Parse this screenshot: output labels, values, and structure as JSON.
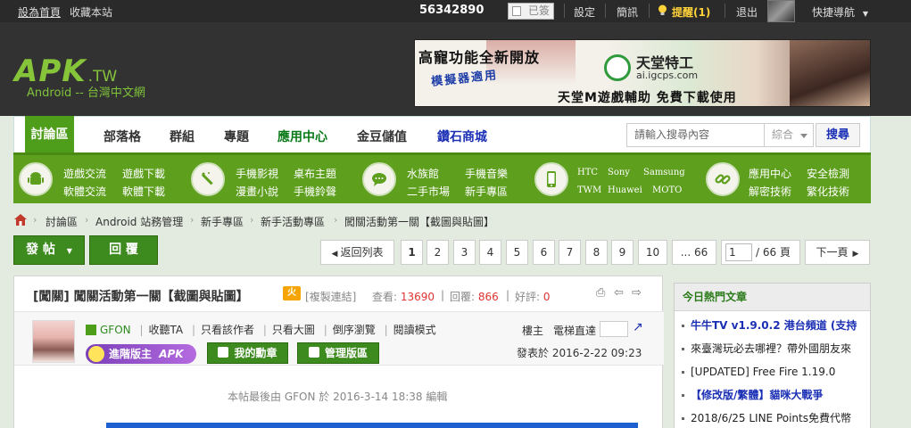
{
  "topbar": {
    "set_home": "設為首頁",
    "bookmark": "收藏本站",
    "user_id": "56342890",
    "signed": "已簽",
    "settings": "設定",
    "messages": "簡訊",
    "remind": "提醒(1)",
    "logout": "退出",
    "quick_nav": "快捷導航"
  },
  "logo": {
    "brand": "APK",
    "tld": ".TW",
    "subtitle": "Android -- 台灣中文網"
  },
  "banner": {
    "line1": "高寵功能全新開放",
    "line2": "模擬器適用",
    "brand": "天堂特工",
    "domain": "ai.igcps.com",
    "tagline": "天堂M遊戲輔助 免費下載使用"
  },
  "nav": {
    "items": [
      "討論區",
      "部落格",
      "群組",
      "專題",
      "應用中心",
      "金豆儲值",
      "鑽石商城"
    ],
    "search_placeholder": "請輸入搜尋內容",
    "search_type": "綜合",
    "search_button": "搜尋"
  },
  "categories": [
    {
      "icon": "android-icon",
      "links": [
        "遊戲交流",
        "遊戲下載",
        "軟體交流",
        "軟體下載"
      ]
    },
    {
      "icon": "magic-wand-icon",
      "links": [
        "手機影視",
        "桌布主題",
        "漫畫小說",
        "手機鈴聲"
      ]
    },
    {
      "icon": "chat-bubble-icon",
      "links": [
        "水族館",
        "手機音樂",
        "二手市場",
        "新手專區"
      ]
    },
    {
      "icon": "smartphone-icon",
      "links": [
        "HTC",
        "Sony",
        "Samsung",
        "TWM",
        "Huawei",
        "MOTO"
      ]
    },
    {
      "icon": "link-icon",
      "links": [
        "應用中心",
        "安全檢測",
        "解密技術",
        "繁化技術"
      ]
    }
  ],
  "breadcrumb": [
    "討論區",
    "Android 站務管理",
    "新手專區",
    "新手活動專區",
    "闖關活動第一關【截圖與貼圖】"
  ],
  "actions": {
    "post": "發 帖",
    "reply": "回 覆"
  },
  "pager": {
    "back": "返回列表",
    "pages": [
      "1",
      "2",
      "3",
      "4",
      "5",
      "6",
      "7",
      "8",
      "9",
      "10",
      "... 66"
    ],
    "current": "1",
    "total": "/ 66 頁",
    "next": "下一頁"
  },
  "thread": {
    "title": "[闖關] 闖關活動第一關【截圖與貼圖】",
    "hot": "火",
    "copy_link": "[複製連結]",
    "views_label": "查看:",
    "views": "13690",
    "replies_label": "回覆:",
    "replies": "866",
    "likes_label": "好評:",
    "likes": "0"
  },
  "author": {
    "name": "GFON",
    "listen": "收聽TA",
    "only_author": "只看該作者",
    "only_big": "只看大圖",
    "reverse": "倒序瀏覽",
    "read_mode": "閱讀模式",
    "rank": "進階版主",
    "medal_btn": "我的勳章",
    "manage_btn": "管理版區",
    "owner": "樓主",
    "elevator": "電梯直達",
    "posted_label": "發表於",
    "posted_at": "2016-2-22 09:23",
    "edit_note": "本帖最後由 GFON 於 2016-3-14 18:38 編輯"
  },
  "sidebar": {
    "title": "今日熱門文章",
    "items": [
      "牛牛TV v1.9.0.2 港台頻道 (支持",
      "來臺灣玩必去哪裡？帶外國朋友來",
      "[UPDATED] Free Fire 1.19.0",
      "【修改版/繁體】貓咪大戰爭",
      "2018/6/25 LINE Points免費代幣"
    ]
  },
  "colors": {
    "accent": "#4f9e1b",
    "nav_blue": "#1b2fb5",
    "hot_red": "#d33333"
  }
}
